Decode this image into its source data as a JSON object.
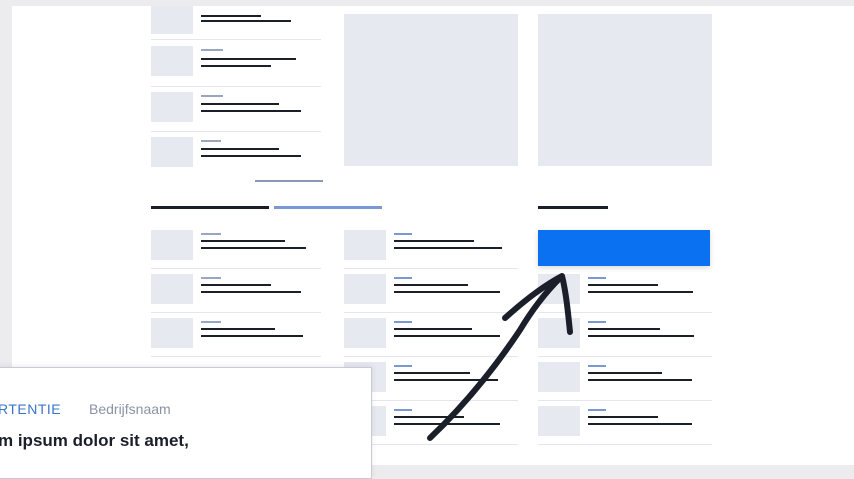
{
  "ad": {
    "label": "RTENTIE",
    "company": "Bedrijfsnaam",
    "title": "m ipsum dolor sit amet,"
  },
  "colors": {
    "accent_button": "#0a72f0",
    "placeholder": "#e6e9f0",
    "ad_label": "#3875c9"
  },
  "icons": [
    "curved-arrow-icon"
  ]
}
